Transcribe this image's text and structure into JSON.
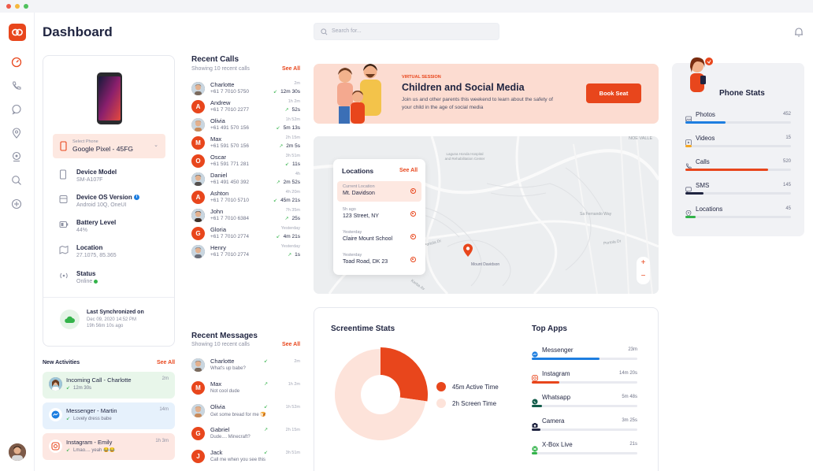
{
  "window": {
    "dots": [
      "#ee5a4a",
      "#f5b83d",
      "#4fc15d"
    ]
  },
  "header": {
    "title": "Dashboard",
    "search_placeholder": "Search for..."
  },
  "device": {
    "select_label": "Select Phone",
    "select_value": "Google Pixel - 45FG",
    "specs": [
      {
        "label": "Device Model",
        "value": "SM-A107F"
      },
      {
        "label": "Device OS Version",
        "value": "Android 10Q, OneUI"
      },
      {
        "label": "Battery Level",
        "value": "44%"
      },
      {
        "label": "Location",
        "value": "27.1075, 85.365"
      },
      {
        "label": "Status",
        "value": "Online"
      }
    ],
    "sync_title": "Last Synchronized on",
    "sync_date": "Dec 09, 2020 14:52 PM",
    "sync_ago": "19h 56m 10s ago"
  },
  "activities": {
    "title": "New Activities",
    "see_all": "See All",
    "items": [
      {
        "title": "Incoming Call - Charlotte",
        "sub": "12m 30s",
        "time": "2m",
        "bg": "#e8f6ea"
      },
      {
        "title": "Messenger - Martin",
        "sub": "Lovely dress babe",
        "time": "14m",
        "bg": "#e6f1fc"
      },
      {
        "title": "Instagram - Emily",
        "sub": "Lmao.... yeah 😂😂",
        "time": "1h 3m",
        "bg": "#fde7e2"
      }
    ]
  },
  "calls": {
    "title": "Recent Calls",
    "subtitle": "Showing 10 recent calls",
    "see_all": "See All",
    "items": [
      {
        "name": "Charlotte",
        "number": "+61 7 7010 5750",
        "time": "2m",
        "duration": "12m 30s",
        "initial": "",
        "color": "#7b6a5d"
      },
      {
        "name": "Andrew",
        "number": "+61 7 7010 2277",
        "time": "1h 2m",
        "duration": "52s",
        "initial": "A",
        "color": "#e8461c"
      },
      {
        "name": "Olivia",
        "number": "+61 491 570 156",
        "time": "1h 52m",
        "duration": "5m 13s",
        "initial": "",
        "color": "#c78a5a"
      },
      {
        "name": "Max",
        "number": "+61 591 570 156",
        "time": "2h 15m",
        "duration": "2m 5s",
        "initial": "M",
        "color": "#e8461c"
      },
      {
        "name": "Oscar",
        "number": "+61 591 771 281",
        "time": "3h 51m",
        "duration": "11s",
        "initial": "O",
        "color": "#e8461c"
      },
      {
        "name": "Daniel",
        "number": "+61 491 450 392",
        "time": "4h",
        "duration": "2m 52s",
        "initial": "",
        "color": "#54504e"
      },
      {
        "name": "Ashton",
        "number": "+61 7 7010 5710",
        "time": "4h 20m",
        "duration": "45m 21s",
        "initial": "A",
        "color": "#e8461c"
      },
      {
        "name": "John",
        "number": "+61 7 7010 6384",
        "time": "7h 35m",
        "duration": "25s",
        "initial": "",
        "color": "#3d3028"
      },
      {
        "name": "Gloria",
        "number": "+61 7 7010 2774",
        "time": "Yesterday",
        "duration": "4m 21s",
        "initial": "G",
        "color": "#e8461c"
      },
      {
        "name": "Henry",
        "number": "+61 7 7010 2774",
        "time": "Yesterday",
        "duration": "1s",
        "initial": "",
        "color": "#6b6f7a"
      }
    ]
  },
  "messages": {
    "title": "Recent Messages",
    "subtitle": "Showing 10 recent calls",
    "see_all": "See All",
    "items": [
      {
        "name": "Charlotte",
        "text": "What's up babe?",
        "time": "2m",
        "initial": "",
        "color": "#7b6a5d"
      },
      {
        "name": "Max",
        "text": "Not cool dude",
        "time": "1h 2m",
        "initial": "M",
        "color": "#e8461c"
      },
      {
        "name": "Olivia",
        "text": "Get some bread for me 🍞",
        "time": "1h 52m",
        "initial": "",
        "color": "#c78a5a"
      },
      {
        "name": "Gabriel",
        "text": "Dude.... Minecraft?",
        "time": "2h 15m",
        "initial": "G",
        "color": "#e8461c"
      },
      {
        "name": "Jack",
        "text": "Call me when you see this",
        "time": "3h 51m",
        "initial": "J",
        "color": "#e8461c"
      }
    ]
  },
  "banner": {
    "eyebrow": "VIRTUAL SESSION",
    "title": "Children and Social Media",
    "text": "Join us and other parents this weekend to learn about the safety of your child in the age of social media",
    "button": "Book Seat"
  },
  "map": {
    "labels": [
      "Laguna Honda Hospital and Rehabilitation Center",
      "NOE VALLE",
      "Portola Dr",
      "Mount Davidson",
      "Sa Fernando Way",
      "Portola Dr",
      "Kerba Av"
    ],
    "locations_title": "Locations",
    "see_all": "See All",
    "locations": [
      {
        "when": "Current Location",
        "place": "Mt. Davidson"
      },
      {
        "when": "5h ago",
        "place": "123 Street, NY"
      },
      {
        "when": "Yesterday",
        "place": "Claire Mount School"
      },
      {
        "when": "Yesterday",
        "place": "Toad Road, DK 23"
      }
    ],
    "zoom_in": "+",
    "zoom_out": "−"
  },
  "screentime": {
    "title": "Screentime Stats",
    "legend": [
      {
        "label": "45m Active Time",
        "color": "#e8461c"
      },
      {
        "label": "2h Screen Time",
        "color": "#fde3da"
      }
    ]
  },
  "chart_data": {
    "type": "pie",
    "categories": [
      "Active Time",
      "Screen Time"
    ],
    "values": [
      45,
      120
    ],
    "units": "minutes",
    "legend_placement": "right"
  },
  "top_apps": {
    "title": "Top Apps",
    "items": [
      {
        "name": "Messenger",
        "time": "23m",
        "fraction": 0.64,
        "color": "#1d7ee0",
        "icon": "messenger-icon"
      },
      {
        "name": "Instagram",
        "time": "14m 20s",
        "fraction": 0.26,
        "color": "#e8461c",
        "icon": "instagram-icon"
      },
      {
        "name": "Whatsapp",
        "time": "5m 48s",
        "fraction": 0.1,
        "color": "#125c4a",
        "icon": "whatsapp-icon"
      },
      {
        "name": "Camera",
        "time": "3m 25s",
        "fraction": 0.08,
        "color": "#1f2440",
        "icon": "camera-icon"
      },
      {
        "name": "X-Box Live",
        "time": "21s",
        "fraction": 0.05,
        "color": "#33b34a",
        "icon": "xbox-icon"
      }
    ]
  },
  "phone_stats": {
    "title": "Phone Stats",
    "items": [
      {
        "label": "Photos",
        "value": "452",
        "fraction": 0.38,
        "color": "#1d7ee0",
        "icon": "image-icon"
      },
      {
        "label": "Videos",
        "value": "15",
        "fraction": 0.06,
        "color": "#f5a623",
        "icon": "video-icon"
      },
      {
        "label": "Calls",
        "value": "520",
        "fraction": 0.78,
        "color": "#e8461c",
        "icon": "phone-icon"
      },
      {
        "label": "SMS",
        "value": "145",
        "fraction": 0.17,
        "color": "#1f2440",
        "icon": "chat-icon"
      },
      {
        "label": "Locations",
        "value": "45",
        "fraction": 0.1,
        "color": "#33b34a",
        "icon": "location-icon"
      }
    ]
  }
}
